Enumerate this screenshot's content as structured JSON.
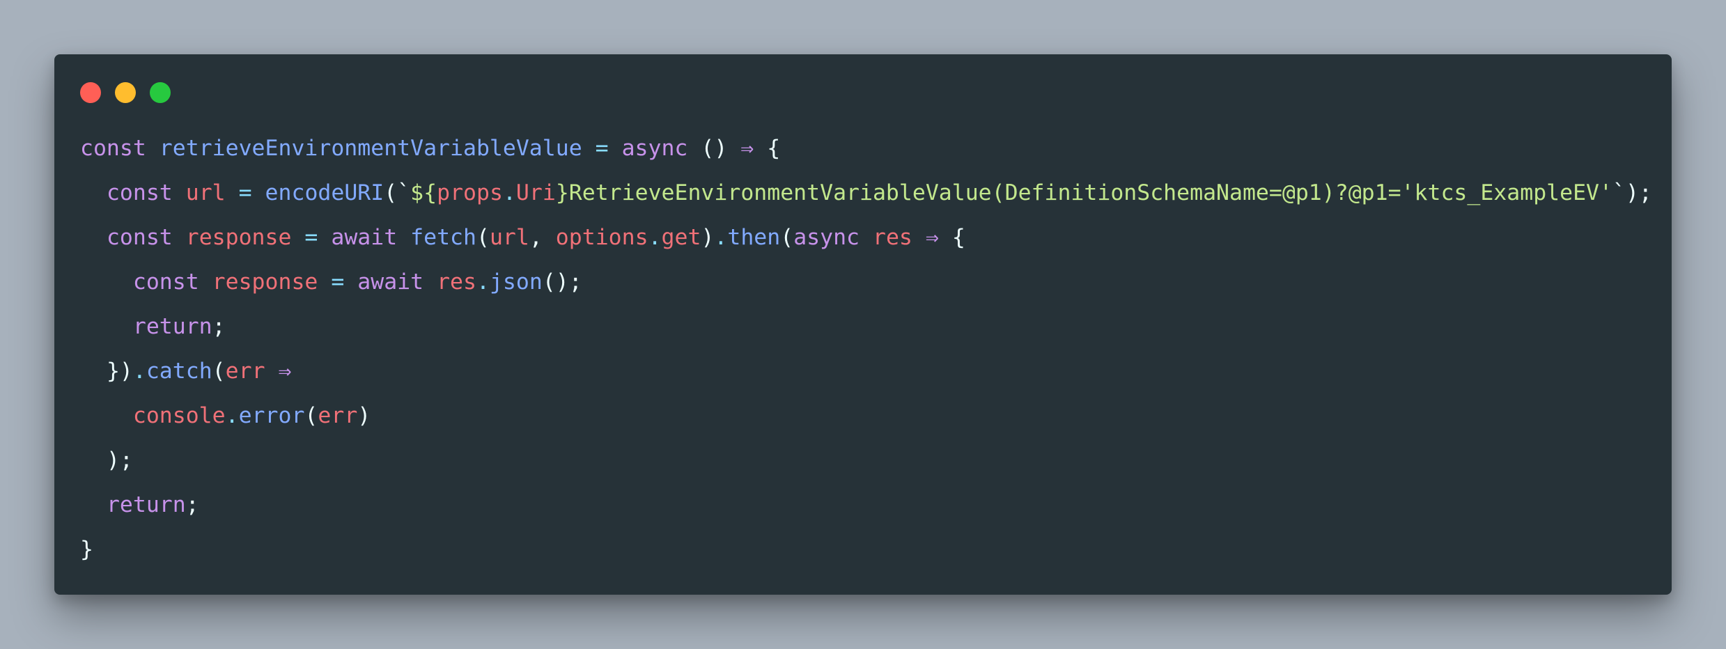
{
  "window": {
    "controls": [
      "close",
      "minimize",
      "maximize"
    ]
  },
  "colors": {
    "keyword": "#c792ea",
    "function": "#82aaff",
    "variable": "#f07178",
    "string": "#c3e88d",
    "punctuation": "#89ddff",
    "plain": "#eeffff",
    "window_bg": "#263238",
    "page_bg": "#a7b1bc"
  },
  "code": {
    "lines": [
      [
        {
          "t": "const",
          "k": "keyword"
        },
        {
          "t": " ",
          "k": "plain"
        },
        {
          "t": "retrieveEnvironmentVariableValue",
          "k": "function"
        },
        {
          "t": " ",
          "k": "plain"
        },
        {
          "t": "=",
          "k": "punctuation"
        },
        {
          "t": " ",
          "k": "plain"
        },
        {
          "t": "async",
          "k": "keyword"
        },
        {
          "t": " ",
          "k": "plain"
        },
        {
          "t": "()",
          "k": "plain"
        },
        {
          "t": " ",
          "k": "plain"
        },
        {
          "t": "⇒",
          "k": "keyword"
        },
        {
          "t": " ",
          "k": "plain"
        },
        {
          "t": "{",
          "k": "plain"
        }
      ],
      [
        {
          "t": "  ",
          "k": "plain"
        },
        {
          "t": "const",
          "k": "keyword"
        },
        {
          "t": " ",
          "k": "plain"
        },
        {
          "t": "url",
          "k": "variable"
        },
        {
          "t": " ",
          "k": "plain"
        },
        {
          "t": "=",
          "k": "punctuation"
        },
        {
          "t": " ",
          "k": "plain"
        },
        {
          "t": "encodeURI",
          "k": "function"
        },
        {
          "t": "(`",
          "k": "plain"
        },
        {
          "t": "${",
          "k": "string"
        },
        {
          "t": "props",
          "k": "variable"
        },
        {
          "t": ".",
          "k": "punctuation"
        },
        {
          "t": "Uri",
          "k": "variable"
        },
        {
          "t": "}RetrieveEnvironmentVariableValue(DefinitionSchemaName=@p1)?@p1='ktcs_ExampleEV'",
          "k": "string"
        },
        {
          "t": "`);",
          "k": "plain"
        }
      ],
      [
        {
          "t": "  ",
          "k": "plain"
        },
        {
          "t": "const",
          "k": "keyword"
        },
        {
          "t": " ",
          "k": "plain"
        },
        {
          "t": "response",
          "k": "variable"
        },
        {
          "t": " ",
          "k": "plain"
        },
        {
          "t": "=",
          "k": "punctuation"
        },
        {
          "t": " ",
          "k": "plain"
        },
        {
          "t": "await",
          "k": "keyword"
        },
        {
          "t": " ",
          "k": "plain"
        },
        {
          "t": "fetch",
          "k": "function"
        },
        {
          "t": "(",
          "k": "plain"
        },
        {
          "t": "url",
          "k": "variable"
        },
        {
          "t": ",",
          "k": "plain"
        },
        {
          "t": " ",
          "k": "plain"
        },
        {
          "t": "options",
          "k": "variable"
        },
        {
          "t": ".",
          "k": "punctuation"
        },
        {
          "t": "get",
          "k": "variable"
        },
        {
          "t": ")",
          "k": "plain"
        },
        {
          "t": ".",
          "k": "punctuation"
        },
        {
          "t": "then",
          "k": "function"
        },
        {
          "t": "(",
          "k": "plain"
        },
        {
          "t": "async",
          "k": "keyword"
        },
        {
          "t": " ",
          "k": "plain"
        },
        {
          "t": "res",
          "k": "variable"
        },
        {
          "t": " ",
          "k": "plain"
        },
        {
          "t": "⇒",
          "k": "keyword"
        },
        {
          "t": " ",
          "k": "plain"
        },
        {
          "t": "{",
          "k": "plain"
        }
      ],
      [
        {
          "t": "    ",
          "k": "plain"
        },
        {
          "t": "const",
          "k": "keyword"
        },
        {
          "t": " ",
          "k": "plain"
        },
        {
          "t": "response",
          "k": "variable"
        },
        {
          "t": " ",
          "k": "plain"
        },
        {
          "t": "=",
          "k": "punctuation"
        },
        {
          "t": " ",
          "k": "plain"
        },
        {
          "t": "await",
          "k": "keyword"
        },
        {
          "t": " ",
          "k": "plain"
        },
        {
          "t": "res",
          "k": "variable"
        },
        {
          "t": ".",
          "k": "punctuation"
        },
        {
          "t": "json",
          "k": "function"
        },
        {
          "t": "();",
          "k": "plain"
        }
      ],
      [
        {
          "t": "    ",
          "k": "plain"
        },
        {
          "t": "return",
          "k": "keyword"
        },
        {
          "t": ";",
          "k": "plain"
        }
      ],
      [
        {
          "t": "  ",
          "k": "plain"
        },
        {
          "t": "})",
          "k": "plain"
        },
        {
          "t": ".",
          "k": "punctuation"
        },
        {
          "t": "catch",
          "k": "function"
        },
        {
          "t": "(",
          "k": "plain"
        },
        {
          "t": "err",
          "k": "variable"
        },
        {
          "t": " ",
          "k": "plain"
        },
        {
          "t": "⇒",
          "k": "keyword"
        }
      ],
      [
        {
          "t": "    ",
          "k": "plain"
        },
        {
          "t": "console",
          "k": "variable"
        },
        {
          "t": ".",
          "k": "punctuation"
        },
        {
          "t": "error",
          "k": "function"
        },
        {
          "t": "(",
          "k": "plain"
        },
        {
          "t": "err",
          "k": "variable"
        },
        {
          "t": ")",
          "k": "plain"
        }
      ],
      [
        {
          "t": "  ",
          "k": "plain"
        },
        {
          "t": ");",
          "k": "plain"
        }
      ],
      [
        {
          "t": "  ",
          "k": "plain"
        },
        {
          "t": "return",
          "k": "keyword"
        },
        {
          "t": ";",
          "k": "plain"
        }
      ],
      [
        {
          "t": "}",
          "k": "plain"
        }
      ]
    ]
  }
}
